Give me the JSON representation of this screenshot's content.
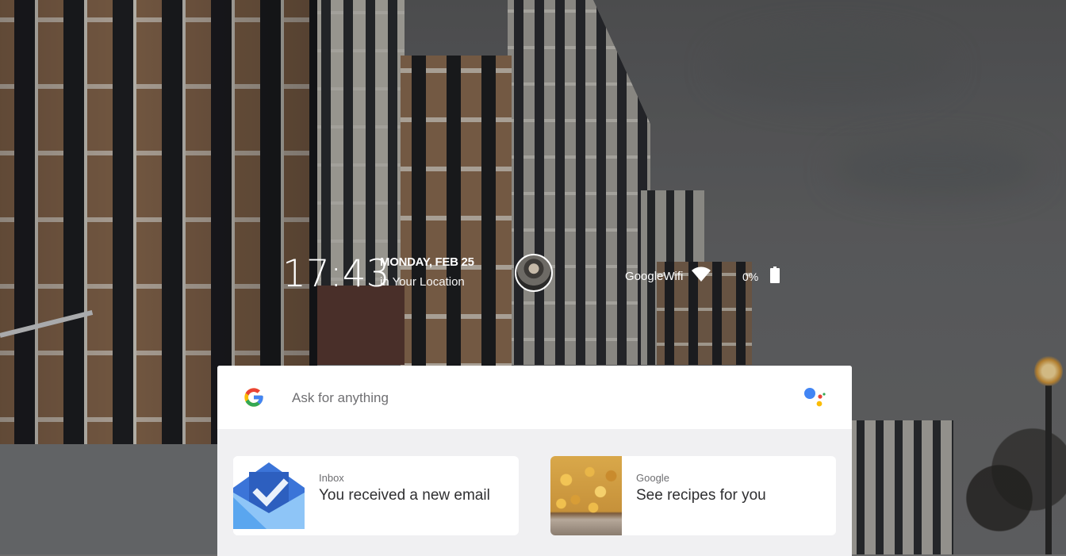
{
  "status": {
    "time": "17:43",
    "date": "MONDAY, FEB 25",
    "location": "in Your Location",
    "wifi_name": "GoogleWifi",
    "battery_percent": "0%"
  },
  "assistant": {
    "search_placeholder": "Ask for anything",
    "suggestions": [
      {
        "source": "Inbox",
        "text": "You received a new email",
        "icon": "inbox-envelope-icon"
      },
      {
        "source": "Google",
        "text": "See recipes for you",
        "icon": "recipe-thumbnail"
      }
    ]
  },
  "colors": {
    "google_blue": "#4285F4",
    "google_red": "#EA4335",
    "google_yellow": "#FBBC05",
    "google_green": "#34A853",
    "inbox_blue": "#4285F4",
    "card_bg": "#F0F0F2"
  }
}
